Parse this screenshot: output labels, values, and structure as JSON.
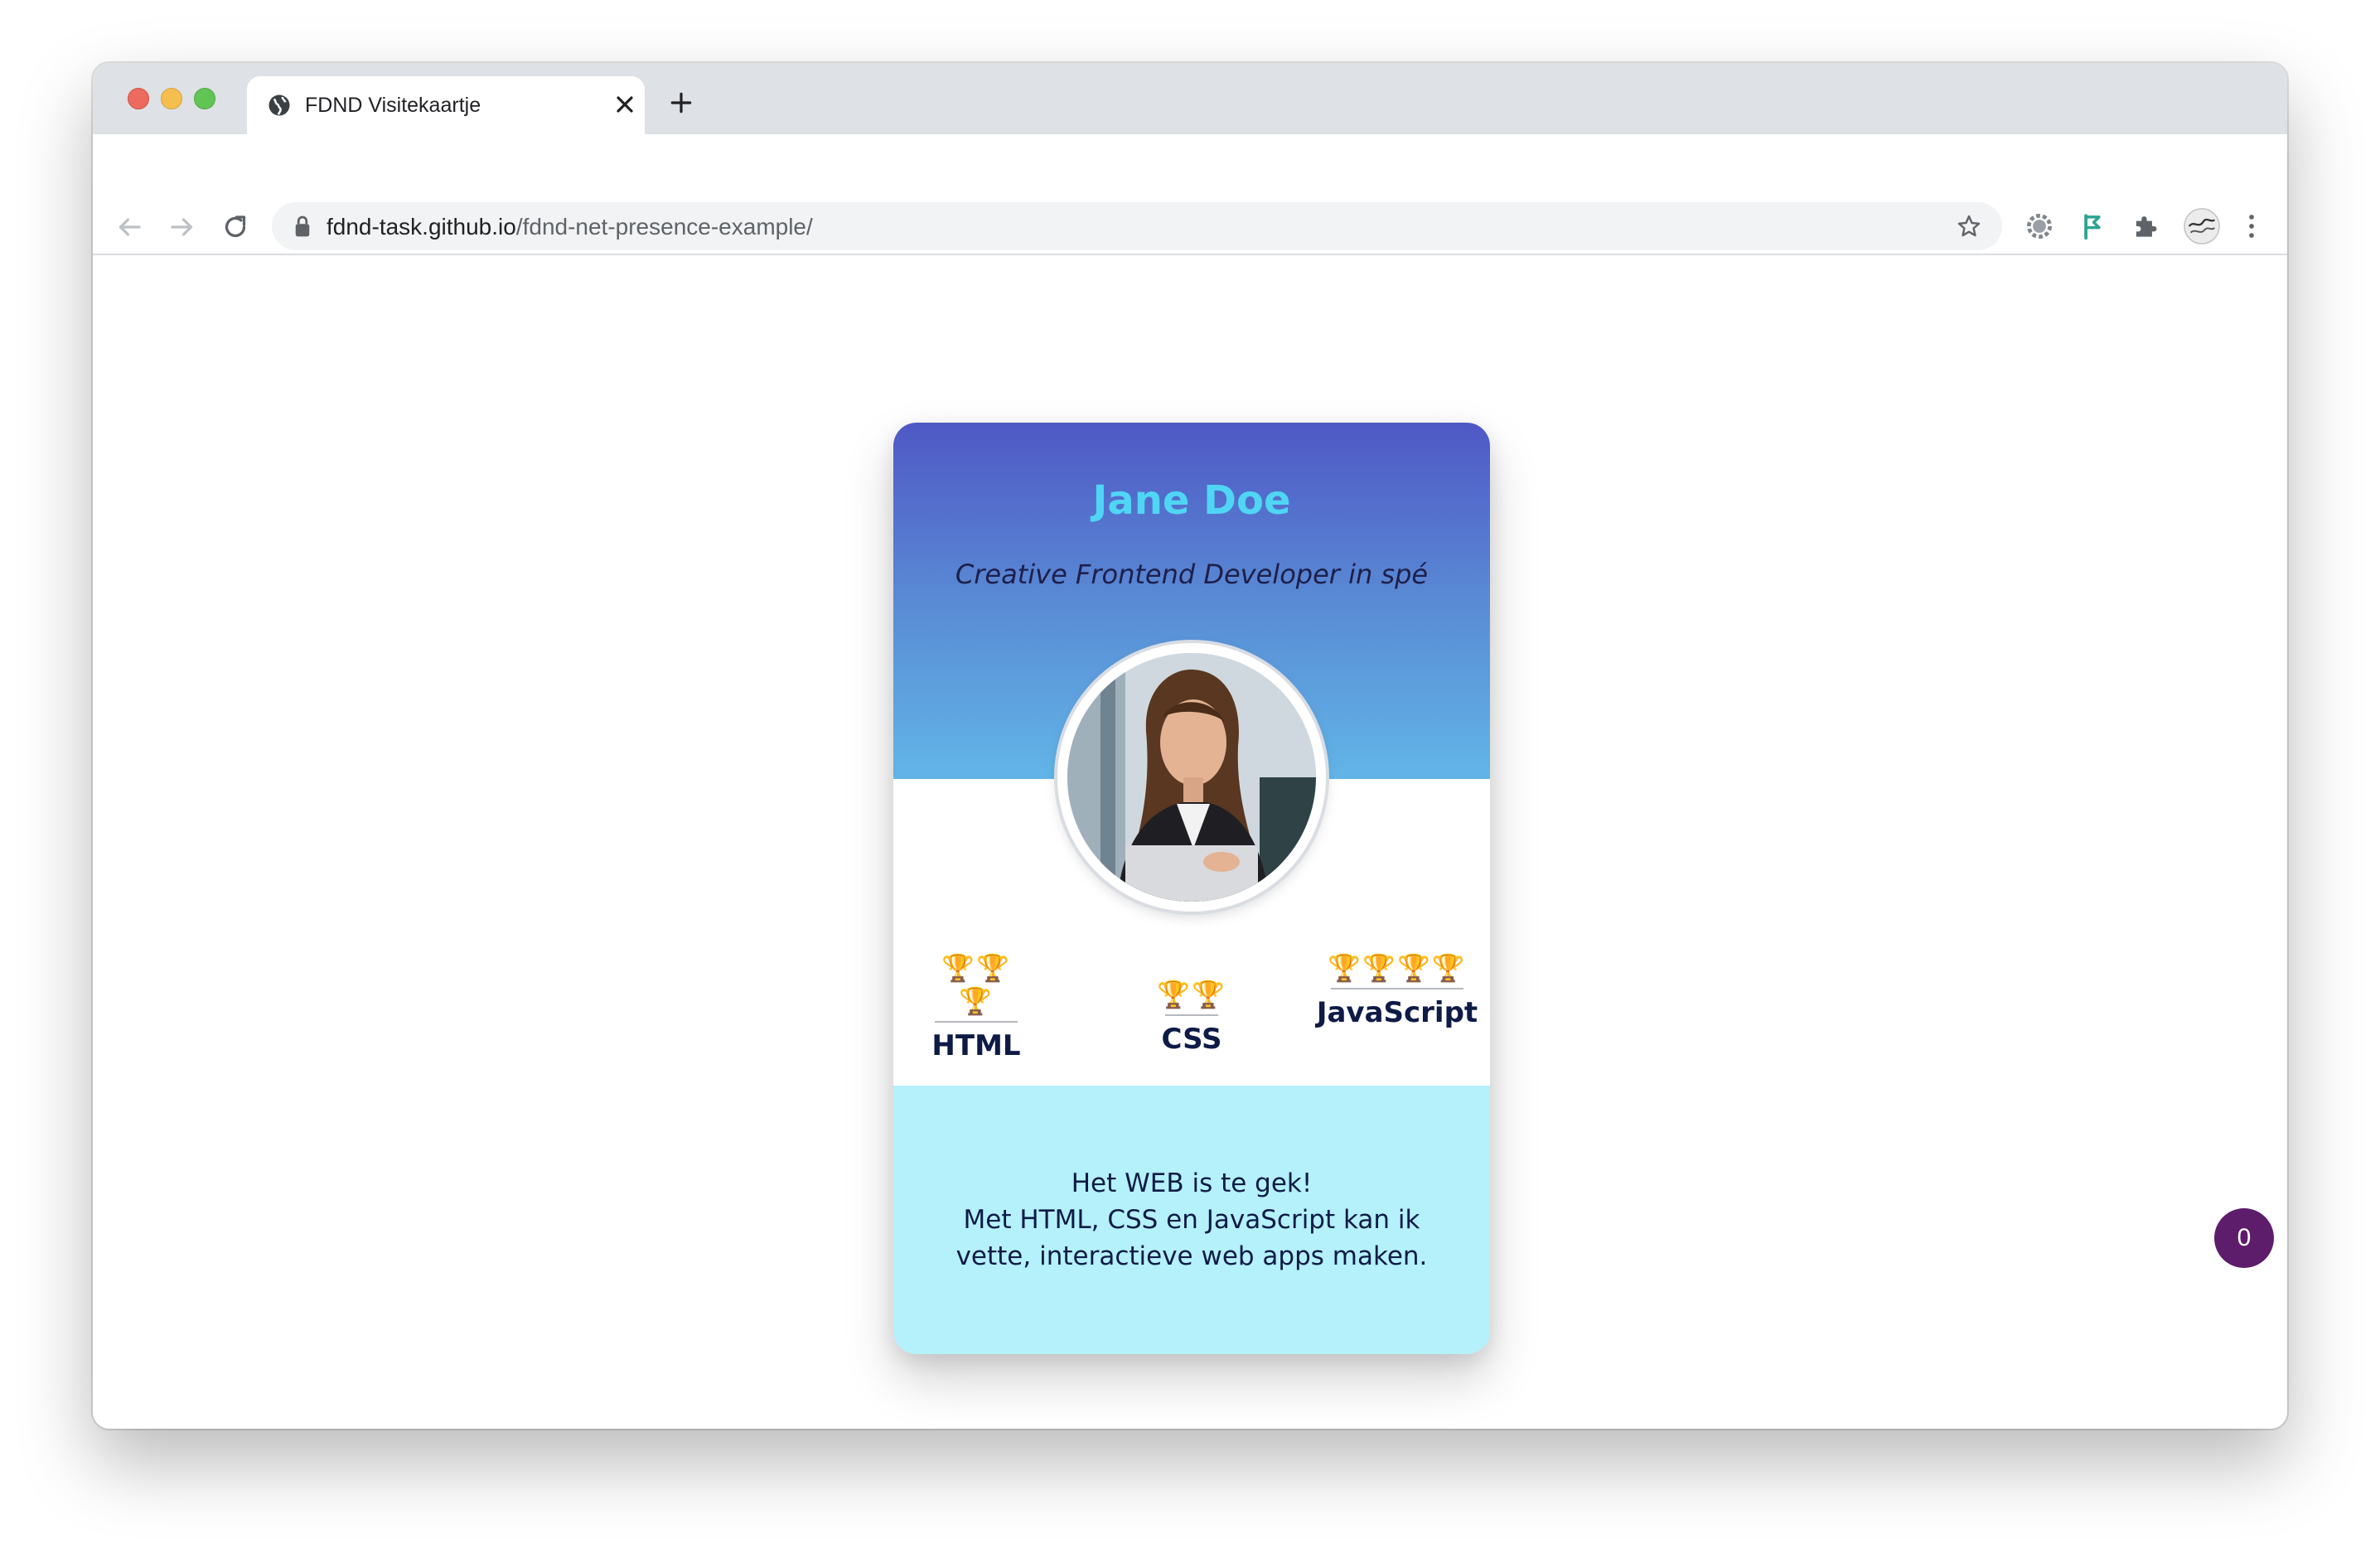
{
  "browser": {
    "tab_title": "FDND Visitekaartje",
    "url_host": "fdnd-task.github.io",
    "url_path": "/fdnd-net-presence-example/"
  },
  "card": {
    "name": "Jane Doe",
    "role": "Creative Frontend Developer in spé",
    "skills": [
      {
        "label": "HTML",
        "trophies": "🏆🏆🏆",
        "level": 3
      },
      {
        "label": "CSS",
        "trophies": "🏆🏆",
        "level": 2
      },
      {
        "label": "JavaScript",
        "trophies": "🏆🏆🏆🏆",
        "level": 4
      }
    ],
    "bio_lines": [
      "Het WEB is te gek!",
      "Met HTML, CSS en JavaScript kan ik",
      "vette, interactieve web apps maken."
    ]
  },
  "counter_badge": "0",
  "colors": {
    "header_gradient_top": "#4f58c5",
    "header_gradient_bottom": "#62b5e8",
    "name": "#4fd6f4",
    "footer_bg": "#b4f1fb",
    "text_dark": "#0e1b47",
    "badge_bg": "#5e1d6b"
  },
  "icons": {
    "tab_favicon": "globe-icon",
    "back": "arrow-left-icon",
    "forward": "arrow-right-icon",
    "reload": "reload-icon",
    "lock": "lock-icon",
    "bookmark": "star-icon",
    "extensions": "puzzle-icon",
    "menu": "kebab-menu-icon"
  }
}
